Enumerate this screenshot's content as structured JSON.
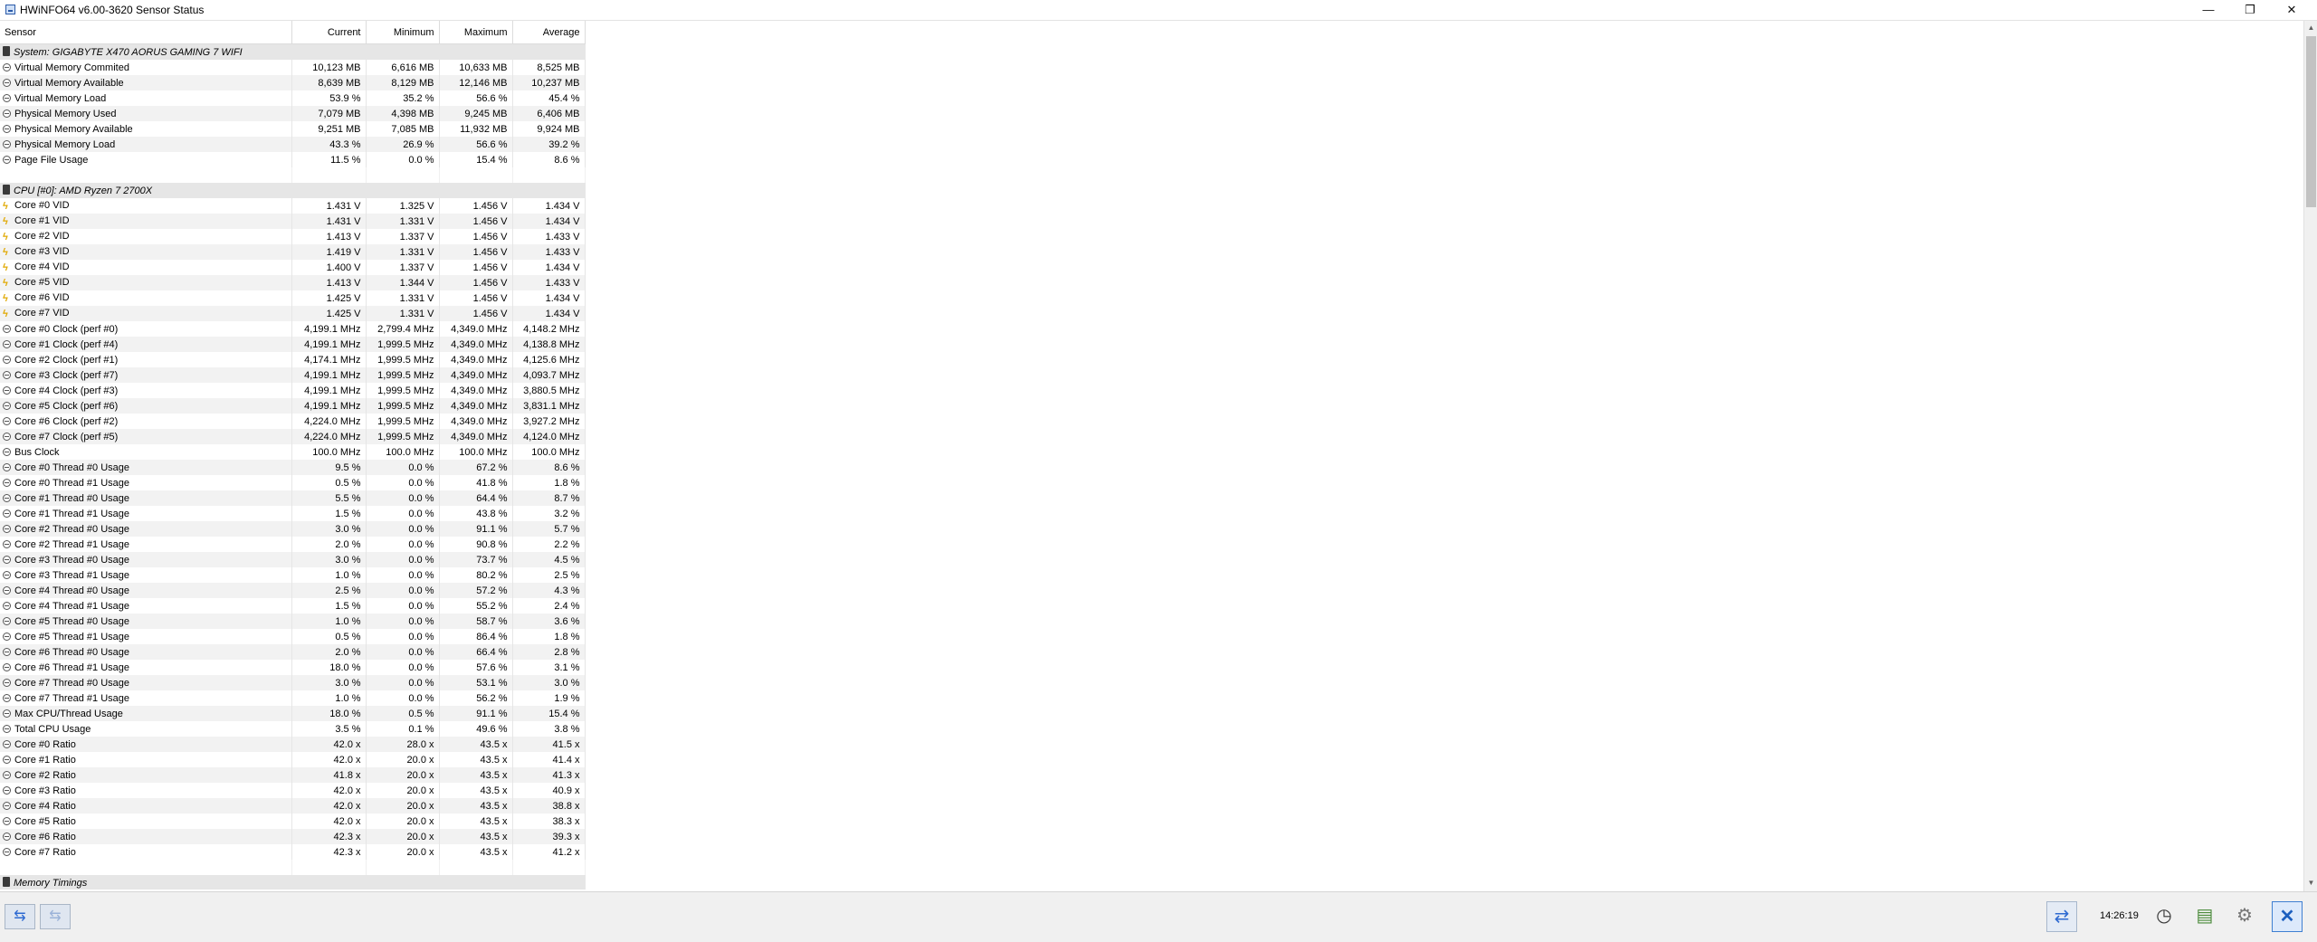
{
  "window": {
    "title": "HWiNFO64 v6.00-3620 Sensor Status",
    "controls": {
      "minimize": "—",
      "restore": "❐",
      "close": "✕"
    }
  },
  "table": {
    "columns": [
      "Sensor",
      "Current",
      "Minimum",
      "Maximum",
      "Average"
    ],
    "rows": [
      {
        "type": "group",
        "label": "System: GIGABYTE X470 AORUS GAMING 7 WIFI",
        "icon": "chip-icon"
      },
      {
        "type": "data",
        "icon": "circle-icon",
        "label": "Virtual Memory Commited",
        "cur": "10,123 MB",
        "min": "6,616 MB",
        "max": "10,633 MB",
        "avg": "8,525 MB"
      },
      {
        "type": "data",
        "icon": "circle-icon",
        "label": "Virtual Memory Available",
        "cur": "8,639 MB",
        "min": "8,129 MB",
        "max": "12,146 MB",
        "avg": "10,237 MB"
      },
      {
        "type": "data",
        "icon": "circle-icon",
        "label": "Virtual Memory Load",
        "cur": "53.9 %",
        "min": "35.2 %",
        "max": "56.6 %",
        "avg": "45.4 %"
      },
      {
        "type": "data",
        "icon": "circle-icon",
        "label": "Physical Memory Used",
        "cur": "7,079 MB",
        "min": "4,398 MB",
        "max": "9,245 MB",
        "avg": "6,406 MB"
      },
      {
        "type": "data",
        "icon": "circle-icon",
        "label": "Physical Memory Available",
        "cur": "9,251 MB",
        "min": "7,085 MB",
        "max": "11,932 MB",
        "avg": "9,924 MB"
      },
      {
        "type": "data",
        "icon": "circle-icon",
        "label": "Physical Memory Load",
        "cur": "43.3 %",
        "min": "26.9 %",
        "max": "56.6 %",
        "avg": "39.2 %"
      },
      {
        "type": "data",
        "icon": "circle-icon",
        "label": "Page File Usage",
        "cur": "11.5 %",
        "min": "0.0 %",
        "max": "15.4 %",
        "avg": "8.6 %"
      },
      {
        "type": "blank"
      },
      {
        "type": "group",
        "label": "CPU [#0]: AMD Ryzen 7 2700X",
        "icon": "chip-icon"
      },
      {
        "type": "data",
        "icon": "bolt-icon",
        "label": "Core #0 VID",
        "cur": "1.431 V",
        "min": "1.325 V",
        "max": "1.456 V",
        "avg": "1.434 V"
      },
      {
        "type": "data",
        "icon": "bolt-icon",
        "label": "Core #1 VID",
        "cur": "1.431 V",
        "min": "1.331 V",
        "max": "1.456 V",
        "avg": "1.434 V"
      },
      {
        "type": "data",
        "icon": "bolt-icon",
        "label": "Core #2 VID",
        "cur": "1.413 V",
        "min": "1.337 V",
        "max": "1.456 V",
        "avg": "1.433 V"
      },
      {
        "type": "data",
        "icon": "bolt-icon",
        "label": "Core #3 VID",
        "cur": "1.419 V",
        "min": "1.331 V",
        "max": "1.456 V",
        "avg": "1.433 V"
      },
      {
        "type": "data",
        "icon": "bolt-icon",
        "label": "Core #4 VID",
        "cur": "1.400 V",
        "min": "1.337 V",
        "max": "1.456 V",
        "avg": "1.434 V"
      },
      {
        "type": "data",
        "icon": "bolt-icon",
        "label": "Core #5 VID",
        "cur": "1.413 V",
        "min": "1.344 V",
        "max": "1.456 V",
        "avg": "1.433 V"
      },
      {
        "type": "data",
        "icon": "bolt-icon",
        "label": "Core #6 VID",
        "cur": "1.425 V",
        "min": "1.331 V",
        "max": "1.456 V",
        "avg": "1.434 V"
      },
      {
        "type": "data",
        "icon": "bolt-icon",
        "label": "Core #7 VID",
        "cur": "1.425 V",
        "min": "1.331 V",
        "max": "1.456 V",
        "avg": "1.434 V"
      },
      {
        "type": "data",
        "icon": "circle-icon",
        "label": "Core #0 Clock (perf #0)",
        "cur": "4,199.1 MHz",
        "min": "2,799.4 MHz",
        "max": "4,349.0 MHz",
        "avg": "4,148.2 MHz"
      },
      {
        "type": "data",
        "icon": "circle-icon",
        "label": "Core #1 Clock (perf #4)",
        "cur": "4,199.1 MHz",
        "min": "1,999.5 MHz",
        "max": "4,349.0 MHz",
        "avg": "4,138.8 MHz"
      },
      {
        "type": "data",
        "icon": "circle-icon",
        "label": "Core #2 Clock (perf #1)",
        "cur": "4,174.1 MHz",
        "min": "1,999.5 MHz",
        "max": "4,349.0 MHz",
        "avg": "4,125.6 MHz"
      },
      {
        "type": "data",
        "icon": "circle-icon",
        "label": "Core #3 Clock (perf #7)",
        "cur": "4,199.1 MHz",
        "min": "1,999.5 MHz",
        "max": "4,349.0 MHz",
        "avg": "4,093.7 MHz"
      },
      {
        "type": "data",
        "icon": "circle-icon",
        "label": "Core #4 Clock (perf #3)",
        "cur": "4,199.1 MHz",
        "min": "1,999.5 MHz",
        "max": "4,349.0 MHz",
        "avg": "3,880.5 MHz"
      },
      {
        "type": "data",
        "icon": "circle-icon",
        "label": "Core #5 Clock (perf #6)",
        "cur": "4,199.1 MHz",
        "min": "1,999.5 MHz",
        "max": "4,349.0 MHz",
        "avg": "3,831.1 MHz"
      },
      {
        "type": "data",
        "icon": "circle-icon",
        "label": "Core #6 Clock (perf #2)",
        "cur": "4,224.0 MHz",
        "min": "1,999.5 MHz",
        "max": "4,349.0 MHz",
        "avg": "3,927.2 MHz"
      },
      {
        "type": "data",
        "icon": "circle-icon",
        "label": "Core #7 Clock (perf #5)",
        "cur": "4,224.0 MHz",
        "min": "1,999.5 MHz",
        "max": "4,349.0 MHz",
        "avg": "4,124.0 MHz"
      },
      {
        "type": "data",
        "icon": "circle-icon",
        "label": "Bus Clock",
        "cur": "100.0 MHz",
        "min": "100.0 MHz",
        "max": "100.0 MHz",
        "avg": "100.0 MHz"
      },
      {
        "type": "data",
        "icon": "circle-icon",
        "label": "Core #0 Thread #0 Usage",
        "cur": "9.5 %",
        "min": "0.0 %",
        "max": "67.2 %",
        "avg": "8.6 %"
      },
      {
        "type": "data",
        "icon": "circle-icon",
        "label": "Core #0 Thread #1 Usage",
        "cur": "0.5 %",
        "min": "0.0 %",
        "max": "41.8 %",
        "avg": "1.8 %"
      },
      {
        "type": "data",
        "icon": "circle-icon",
        "label": "Core #1 Thread #0 Usage",
        "cur": "5.5 %",
        "min": "0.0 %",
        "max": "64.4 %",
        "avg": "8.7 %"
      },
      {
        "type": "data",
        "icon": "circle-icon",
        "label": "Core #1 Thread #1 Usage",
        "cur": "1.5 %",
        "min": "0.0 %",
        "max": "43.8 %",
        "avg": "3.2 %"
      },
      {
        "type": "data",
        "icon": "circle-icon",
        "label": "Core #2 Thread #0 Usage",
        "cur": "3.0 %",
        "min": "0.0 %",
        "max": "91.1 %",
        "avg": "5.7 %"
      },
      {
        "type": "data",
        "icon": "circle-icon",
        "label": "Core #2 Thread #1 Usage",
        "cur": "2.0 %",
        "min": "0.0 %",
        "max": "90.8 %",
        "avg": "2.2 %"
      },
      {
        "type": "data",
        "icon": "circle-icon",
        "label": "Core #3 Thread #0 Usage",
        "cur": "3.0 %",
        "min": "0.0 %",
        "max": "73.7 %",
        "avg": "4.5 %"
      },
      {
        "type": "data",
        "icon": "circle-icon",
        "label": "Core #3 Thread #1 Usage",
        "cur": "1.0 %",
        "min": "0.0 %",
        "max": "80.2 %",
        "avg": "2.5 %"
      },
      {
        "type": "data",
        "icon": "circle-icon",
        "label": "Core #4 Thread #0 Usage",
        "cur": "2.5 %",
        "min": "0.0 %",
        "max": "57.2 %",
        "avg": "4.3 %"
      },
      {
        "type": "data",
        "icon": "circle-icon",
        "label": "Core #4 Thread #1 Usage",
        "cur": "1.5 %",
        "min": "0.0 %",
        "max": "55.2 %",
        "avg": "2.4 %"
      },
      {
        "type": "data",
        "icon": "circle-icon",
        "label": "Core #5 Thread #0 Usage",
        "cur": "1.0 %",
        "min": "0.0 %",
        "max": "58.7 %",
        "avg": "3.6 %"
      },
      {
        "type": "data",
        "icon": "circle-icon",
        "label": "Core #5 Thread #1 Usage",
        "cur": "0.5 %",
        "min": "0.0 %",
        "max": "86.4 %",
        "avg": "1.8 %"
      },
      {
        "type": "data",
        "icon": "circle-icon",
        "label": "Core #6 Thread #0 Usage",
        "cur": "2.0 %",
        "min": "0.0 %",
        "max": "66.4 %",
        "avg": "2.8 %"
      },
      {
        "type": "data",
        "icon": "circle-icon",
        "label": "Core #6 Thread #1 Usage",
        "cur": "18.0 %",
        "min": "0.0 %",
        "max": "57.6 %",
        "avg": "3.1 %"
      },
      {
        "type": "data",
        "icon": "circle-icon",
        "label": "Core #7 Thread #0 Usage",
        "cur": "3.0 %",
        "min": "0.0 %",
        "max": "53.1 %",
        "avg": "3.0 %"
      },
      {
        "type": "data",
        "icon": "circle-icon",
        "label": "Core #7 Thread #1 Usage",
        "cur": "1.0 %",
        "min": "0.0 %",
        "max": "56.2 %",
        "avg": "1.9 %"
      },
      {
        "type": "data",
        "icon": "circle-icon",
        "label": "Max CPU/Thread Usage",
        "cur": "18.0 %",
        "min": "0.5 %",
        "max": "91.1 %",
        "avg": "15.4 %"
      },
      {
        "type": "data",
        "icon": "circle-icon",
        "label": "Total CPU Usage",
        "cur": "3.5 %",
        "min": "0.1 %",
        "max": "49.6 %",
        "avg": "3.8 %"
      },
      {
        "type": "data",
        "icon": "circle-icon",
        "label": "Core #0 Ratio",
        "cur": "42.0 x",
        "min": "28.0 x",
        "max": "43.5 x",
        "avg": "41.5 x"
      },
      {
        "type": "data",
        "icon": "circle-icon",
        "label": "Core #1 Ratio",
        "cur": "42.0 x",
        "min": "20.0 x",
        "max": "43.5 x",
        "avg": "41.4 x"
      },
      {
        "type": "data",
        "icon": "circle-icon",
        "label": "Core #2 Ratio",
        "cur": "41.8 x",
        "min": "20.0 x",
        "max": "43.5 x",
        "avg": "41.3 x"
      },
      {
        "type": "data",
        "icon": "circle-icon",
        "label": "Core #3 Ratio",
        "cur": "42.0 x",
        "min": "20.0 x",
        "max": "43.5 x",
        "avg": "40.9 x"
      },
      {
        "type": "data",
        "icon": "circle-icon",
        "label": "Core #4 Ratio",
        "cur": "42.0 x",
        "min": "20.0 x",
        "max": "43.5 x",
        "avg": "38.8 x"
      },
      {
        "type": "data",
        "icon": "circle-icon",
        "label": "Core #5 Ratio",
        "cur": "42.0 x",
        "min": "20.0 x",
        "max": "43.5 x",
        "avg": "38.3 x"
      },
      {
        "type": "data",
        "icon": "circle-icon",
        "label": "Core #6 Ratio",
        "cur": "42.3 x",
        "min": "20.0 x",
        "max": "43.5 x",
        "avg": "39.3 x"
      },
      {
        "type": "data",
        "icon": "circle-icon",
        "label": "Core #7 Ratio",
        "cur": "42.3 x",
        "min": "20.0 x",
        "max": "43.5 x",
        "avg": "41.2 x"
      },
      {
        "type": "blank"
      },
      {
        "type": "group",
        "label": "Memory Timings",
        "icon": "chip-icon"
      }
    ]
  },
  "toolbar": {
    "nav_prev_glyph": "⇆",
    "nav_next_glyph": "⇆",
    "network_glyph": "⇄",
    "clock": "14:26:19",
    "timer_glyph": "◷",
    "report_glyph": "▤",
    "settings_glyph": "⚙",
    "exit_glyph": "✕"
  }
}
